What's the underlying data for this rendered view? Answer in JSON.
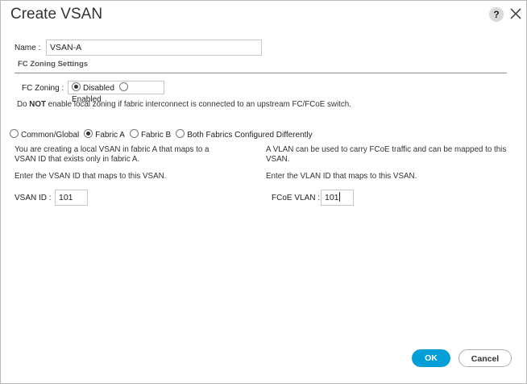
{
  "dialog": {
    "title": "Create VSAN",
    "help_icon": "?",
    "close_icon": "close-icon"
  },
  "name_field": {
    "label": "Name :",
    "value": "VSAN-A"
  },
  "fc_zoning_settings": {
    "section_title": "FC Zoning Settings",
    "label": "FC Zoning :",
    "options": [
      "Disabled",
      "Enabled"
    ],
    "selected": "Disabled",
    "note_prefix": "Do ",
    "note_bold": "NOT",
    "note_suffix": " enable local zoning if fabric interconnect is connected to an upstream FC/FCoE switch."
  },
  "fabric": {
    "options": [
      "Common/Global",
      "Fabric A",
      "Fabric B",
      "Both Fabrics Configured Differently"
    ],
    "selected": "Fabric A"
  },
  "left_panel": {
    "description": "You are creating a local VSAN in fabric A that maps to a VSAN ID that exists only in fabric A.",
    "instruction": "Enter the VSAN ID that maps to this VSAN.",
    "vsan_id_label": "VSAN ID :",
    "vsan_id_value": "101"
  },
  "right_panel": {
    "description": "A VLAN can be used to carry FCoE traffic and can be mapped to this VSAN.",
    "instruction": "Enter the VLAN ID that maps to this VSAN.",
    "fcoe_vlan_label": "FCoE VLAN :",
    "fcoe_vlan_value": "101"
  },
  "buttons": {
    "ok_label": "OK",
    "cancel_label": "Cancel"
  },
  "colors": {
    "ok_button": "#049fd9",
    "border": "#c7c7c7"
  }
}
